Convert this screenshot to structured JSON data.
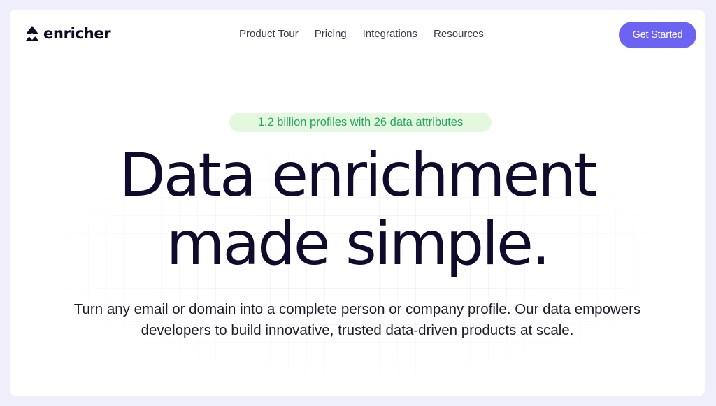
{
  "brand": {
    "name": "enricher",
    "logo_icon": "mountain-icon"
  },
  "nav": {
    "items": [
      {
        "label": "Product Tour"
      },
      {
        "label": "Pricing"
      },
      {
        "label": "Integrations"
      },
      {
        "label": "Resources"
      }
    ],
    "cta_label": "Get Started"
  },
  "hero": {
    "badge": "1.2 billion profiles with 26 data attributes",
    "headline_line1": "Data enrichment",
    "headline_line2": "made simple.",
    "subtext_line1": "Turn any email or domain into a complete person or company profile. Our data empowers",
    "subtext_line2": "developers to build innovative, trusted data-driven products at scale."
  },
  "colors": {
    "accent": "#6c63f2",
    "badge_bg": "#e3f8dc",
    "badge_text": "#2aa36b",
    "headline": "#0e0b2d",
    "page_bg": "#efeefb"
  }
}
